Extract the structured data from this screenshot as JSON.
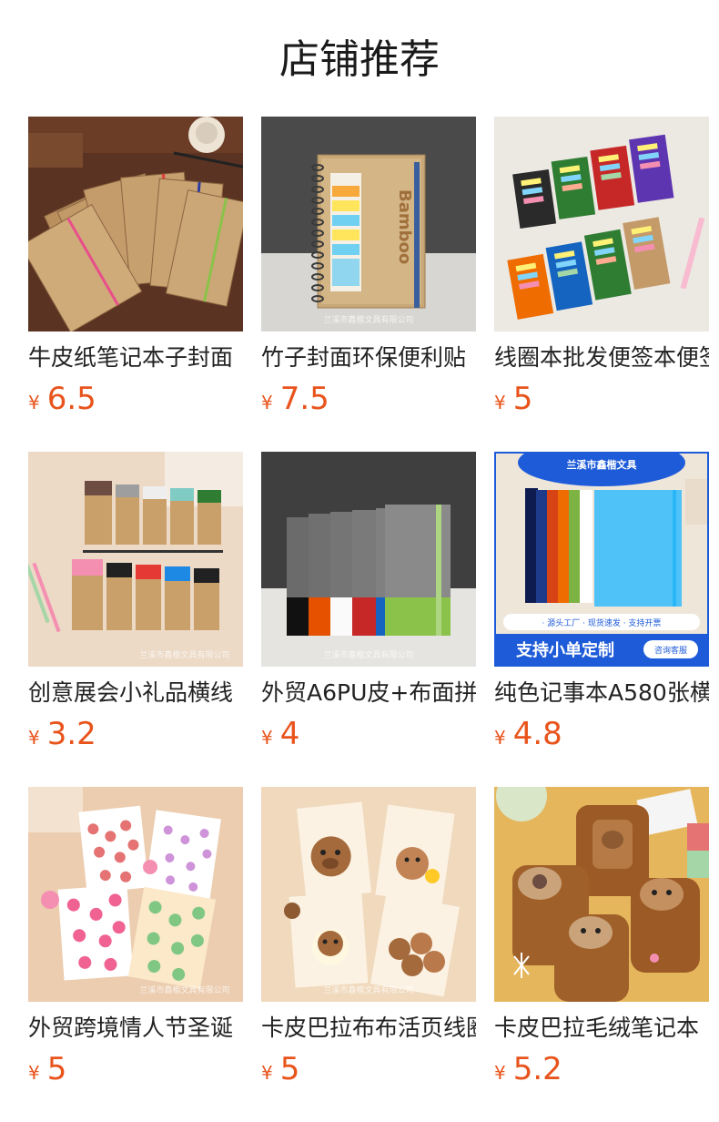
{
  "section_title": "店铺推荐",
  "currency_symbol": "¥",
  "watermark": "兰溪市鑫楷文具有限公司",
  "products": [
    {
      "name": "牛皮纸笔记本子封面",
      "price": "6.5"
    },
    {
      "name": "竹子封面环保便利贴",
      "price": "7.5",
      "cover_text": "Bamboo"
    },
    {
      "name": "线圈本批发便签本便签",
      "price": "5"
    },
    {
      "name": "创意展会小礼品横线",
      "price": "3.2"
    },
    {
      "name": "外贸A6PU皮+布面拼",
      "price": "4"
    },
    {
      "name": "纯色记事本A580张横",
      "price": "4.8",
      "banner_top": "兰溪市鑫楷文具",
      "banner_features": "· 源头工厂  · 现货速发  · 支持开票",
      "banner_main": "支持小单定制",
      "banner_button": "咨询客服"
    },
    {
      "name": "外贸跨境情人节圣诞",
      "price": "5"
    },
    {
      "name": "卡皮巴拉布布活页线圈",
      "price": "5"
    },
    {
      "name": "卡皮巴拉毛绒笔记本",
      "price": "5.2"
    }
  ],
  "colors": {
    "price": "#e8541c",
    "title": "#1a1a1a"
  }
}
